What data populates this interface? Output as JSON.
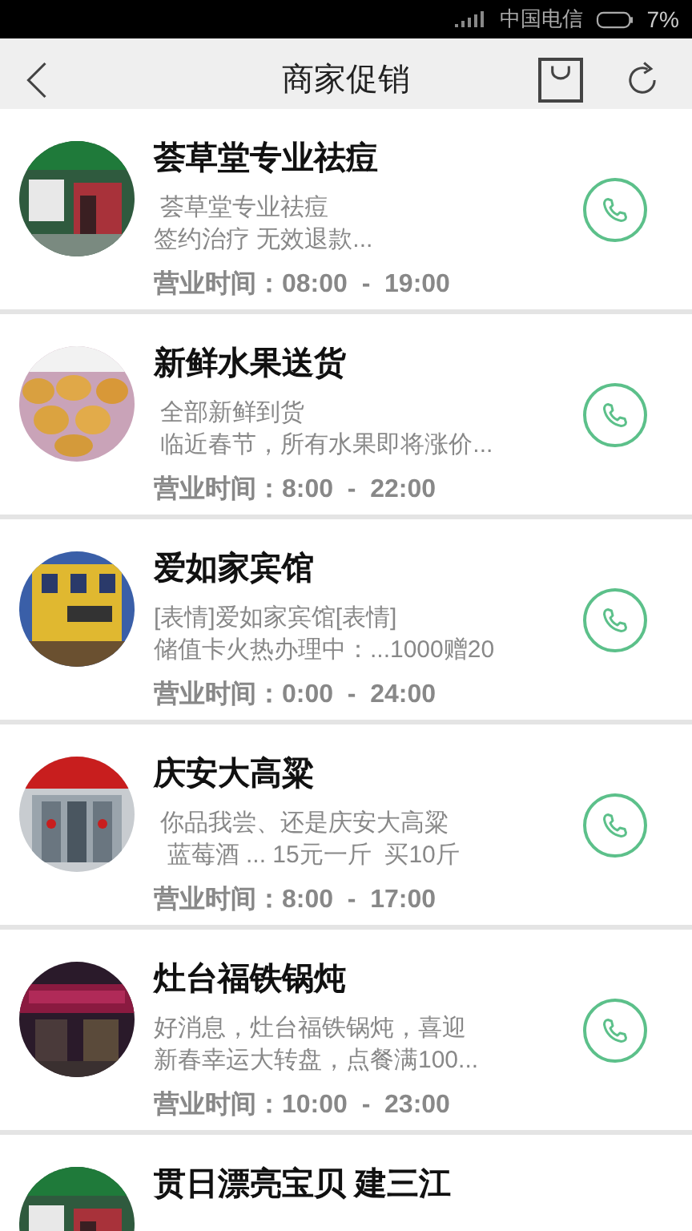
{
  "status_bar": {
    "carrier": "中国电信",
    "battery": "7%"
  },
  "header": {
    "title": "商家促销"
  },
  "merchants": [
    {
      "name": "荟草堂专业祛痘",
      "desc": [
        " 荟草堂专业祛痘",
        "签约治疗 无效退款..."
      ],
      "hours": "营业时间：08:00  -  19:00"
    },
    {
      "name": "新鲜水果送货",
      "desc": [
        " 全部新鲜到货",
        " 临近春节，所有水果即将涨价..."
      ],
      "hours": "营业时间：8:00  -  22:00"
    },
    {
      "name": "爱如家宾馆",
      "desc": [
        "[表情]爱如家宾馆[表情]",
        "储值卡火热办理中：...1000赠20"
      ],
      "hours": "营业时间：0:00  -  24:00"
    },
    {
      "name": "庆安大高粱",
      "desc": [
        " 你品我尝、还是庆安大高粱",
        "  蓝莓酒 ... 15元一斤  买10斤"
      ],
      "hours": "营业时间：8:00  -  17:00"
    },
    {
      "name": "灶台福铁锅炖",
      "desc": [
        "好消息，灶台福铁锅炖，喜迎",
        "新春幸运大转盘，点餐满100..."
      ],
      "hours": "营业时间：10:00  -  23:00"
    },
    {
      "name": "贯日漂亮宝贝 建三江"
    }
  ]
}
